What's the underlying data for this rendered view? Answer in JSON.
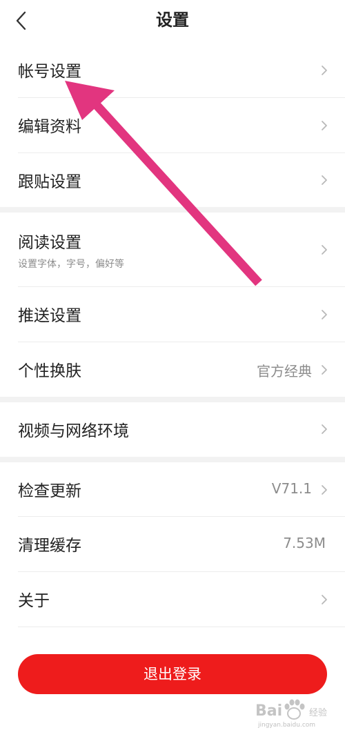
{
  "header": {
    "title": "设置"
  },
  "settings": {
    "account": {
      "label": "帐号设置"
    },
    "edit_profile": {
      "label": "编辑资料"
    },
    "follow_post": {
      "label": "跟贴设置"
    },
    "reading": {
      "label": "阅读设置",
      "sublabel": "设置字体，字号，偏好等"
    },
    "push": {
      "label": "推送设置"
    },
    "skin": {
      "label": "个性换肤",
      "value": "官方经典"
    },
    "video_network": {
      "label": "视频与网络环境"
    },
    "check_update": {
      "label": "检查更新",
      "value": "V71.1"
    },
    "clear_cache": {
      "label": "清理缓存",
      "value": "7.53M"
    },
    "about": {
      "label": "关于"
    }
  },
  "logout": {
    "label": "退出登录"
  },
  "annotation": {
    "color": "#e2357f"
  },
  "watermark": {
    "brand": "Bai",
    "brand_cn": "经验",
    "url": "jingyan.baidu.com"
  },
  "colors": {
    "accent_red": "#ee1c1c",
    "text_primary": "#222222",
    "text_secondary": "#8c8c8c",
    "section_gap": "#f2f2f2"
  },
  "icons": {
    "back": "chevron-left-icon",
    "row_arrow": "chevron-right-icon"
  }
}
